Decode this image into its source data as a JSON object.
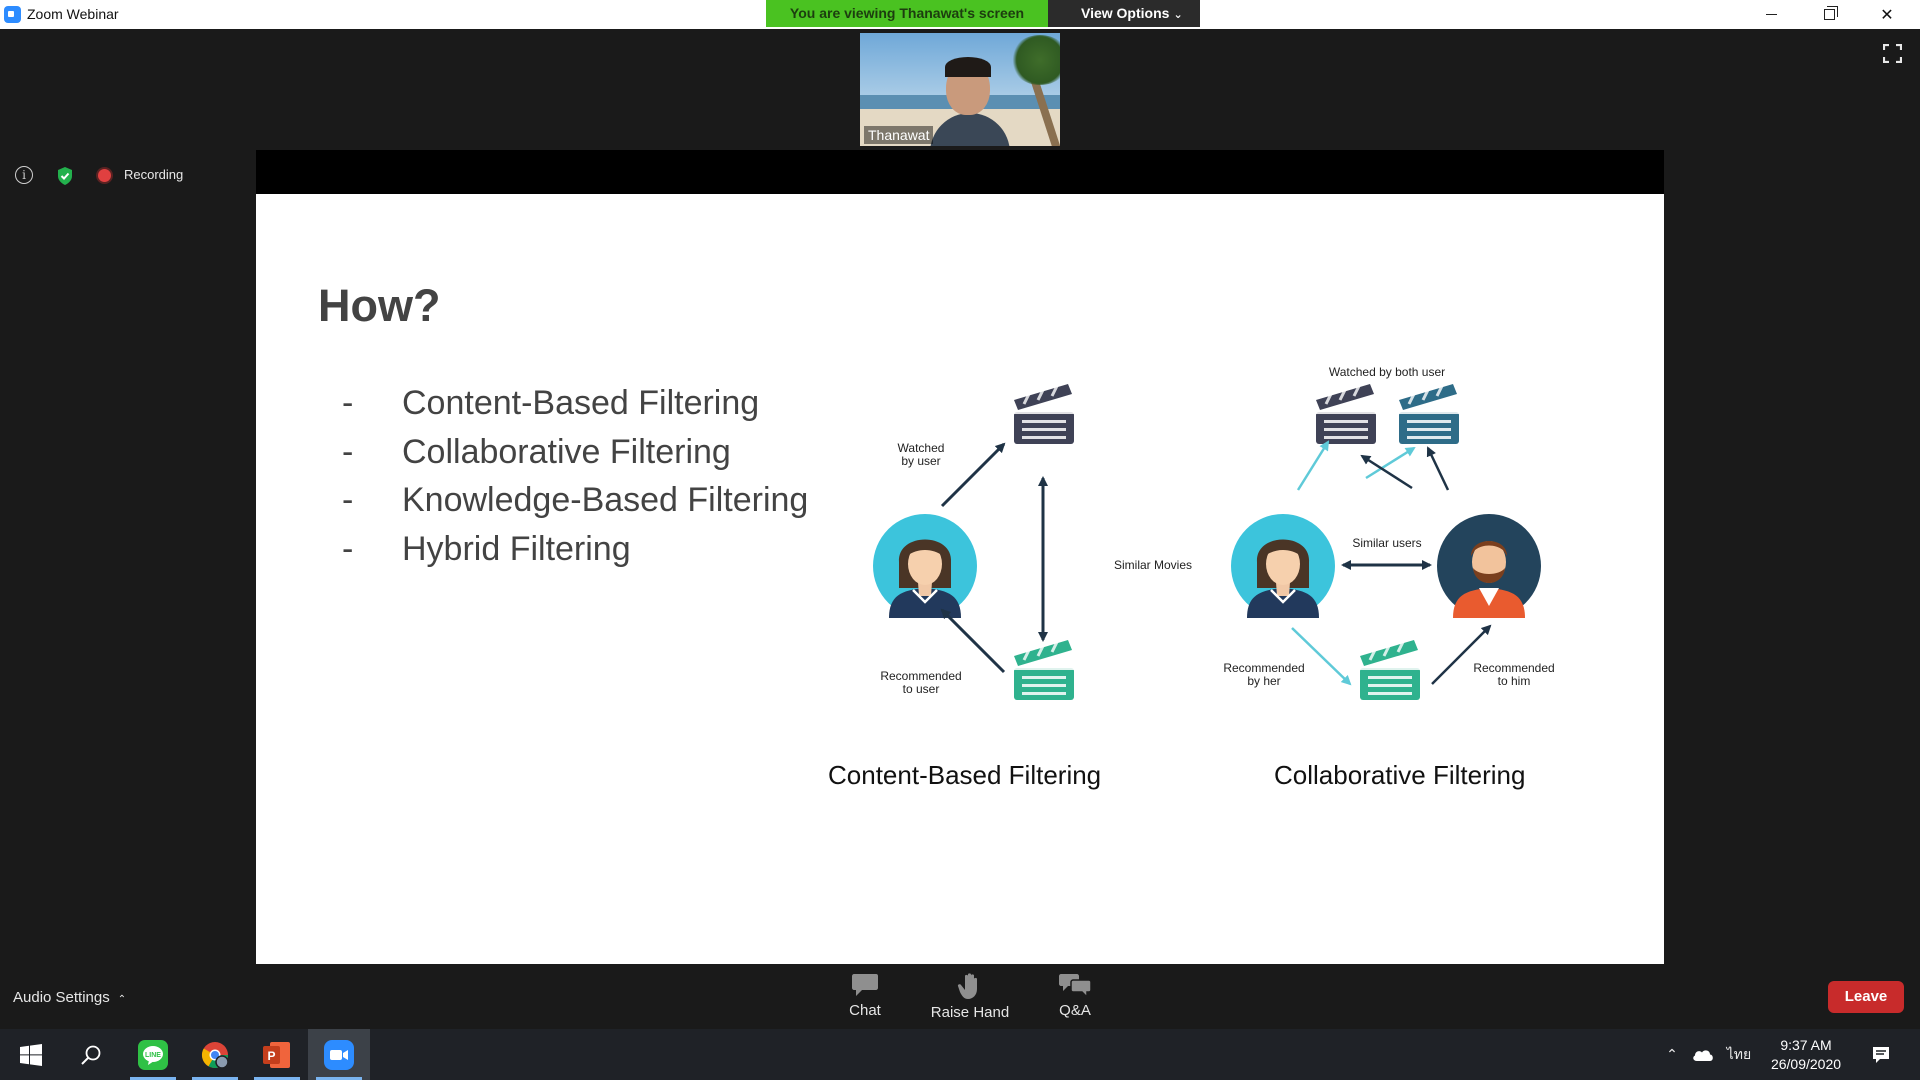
{
  "window": {
    "title": "Zoom Webinar",
    "share_banner": "You are viewing Thanawat's screen",
    "view_options_label": "View Options"
  },
  "participant": {
    "name": "Thanawat"
  },
  "status": {
    "recording_label": "Recording"
  },
  "slide": {
    "title": "How?",
    "bullets": [
      {
        "dash": "-",
        "text": "Content-Based Filtering"
      },
      {
        "dash": "-",
        "text": "Collaborative Filtering"
      },
      {
        "dash": "-",
        "text": "Knowledge-Based Filtering"
      },
      {
        "dash": "-",
        "text": "Hybrid Filtering"
      }
    ],
    "content_based": {
      "caption": "Content-Based Filtering",
      "watched_label": [
        "Watched",
        "by user"
      ],
      "similar_label": "Similar Movies",
      "recommended_label": [
        "Recommended",
        "to user"
      ]
    },
    "collaborative": {
      "caption": "Collaborative Filtering",
      "watched_both_label": "Watched by both user",
      "similar_users_label": "Similar users",
      "recommended_her_label": [
        "Recommended",
        "by her"
      ],
      "recommended_him_label": [
        "Recommended",
        "to him"
      ]
    },
    "colors": {
      "clapper_dark": "#3f4256",
      "clapper_teal": "#2e6c88",
      "clapper_green": "#2fb28e",
      "avatar_cyan": "#3cc4dc",
      "avatar_navy": "#23445c",
      "arrow_light": "#5fcad8",
      "arrow_dark": "#1f3346"
    }
  },
  "toolbar": {
    "audio_settings_label": "Audio Settings",
    "chat_label": "Chat",
    "raise_hand_label": "Raise Hand",
    "qa_label": "Q&A",
    "leave_label": "Leave"
  },
  "taskbar": {
    "language_indicator": "ไทย",
    "time": "9:37 AM",
    "date": "26/09/2020"
  }
}
